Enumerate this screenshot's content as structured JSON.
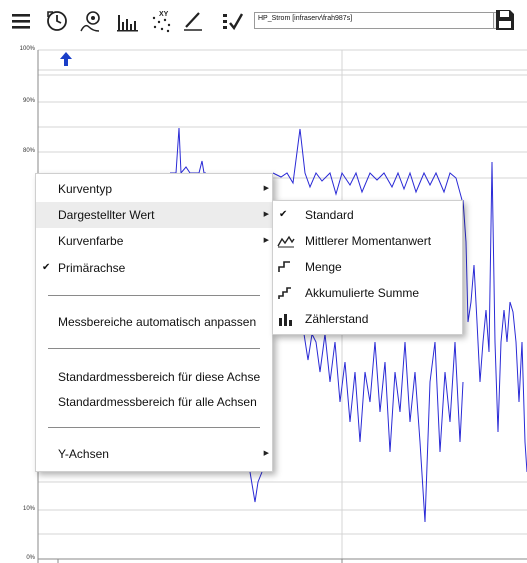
{
  "toolbar": {
    "icons": [
      "menu-icon",
      "history-icon",
      "curve-settings-icon",
      "bar-chart-icon",
      "xy-scatter-icon",
      "pen-icon",
      "checklist-icon",
      "save-icon"
    ],
    "series_selected": "HP_Strom [infraserv\\frah987s]"
  },
  "chart": {
    "y_ticks": [
      "100%",
      "90%",
      "80%",
      "10%",
      "0%"
    ],
    "line_color": "#2a2ad6"
  },
  "context_menu": {
    "items": [
      {
        "label": "Kurventyp",
        "submenu": true
      },
      {
        "label": "Dargestellter Wert",
        "submenu": true,
        "highlighted": true
      },
      {
        "label": "Kurvenfarbe",
        "submenu": true
      },
      {
        "label": "Primärachse",
        "checked": true
      },
      {
        "label": "Messbereiche automatisch anpassen"
      },
      {
        "label": "Standardmessbereich für diese Achse"
      },
      {
        "label": "Standardmessbereich für alle Achsen"
      },
      {
        "label": "Y-Achsen",
        "submenu": true
      }
    ]
  },
  "submenu": {
    "items": [
      {
        "label": "Standard",
        "checked": true,
        "icon": ""
      },
      {
        "label": "Mittlerer Momentanwert",
        "icon": "average-line-icon"
      },
      {
        "label": "Menge",
        "icon": "step-quantity-icon"
      },
      {
        "label": "Akkumulierte Summe",
        "icon": "accumulated-step-icon"
      },
      {
        "label": "Zählerstand",
        "icon": "meter-bars-icon"
      }
    ]
  }
}
